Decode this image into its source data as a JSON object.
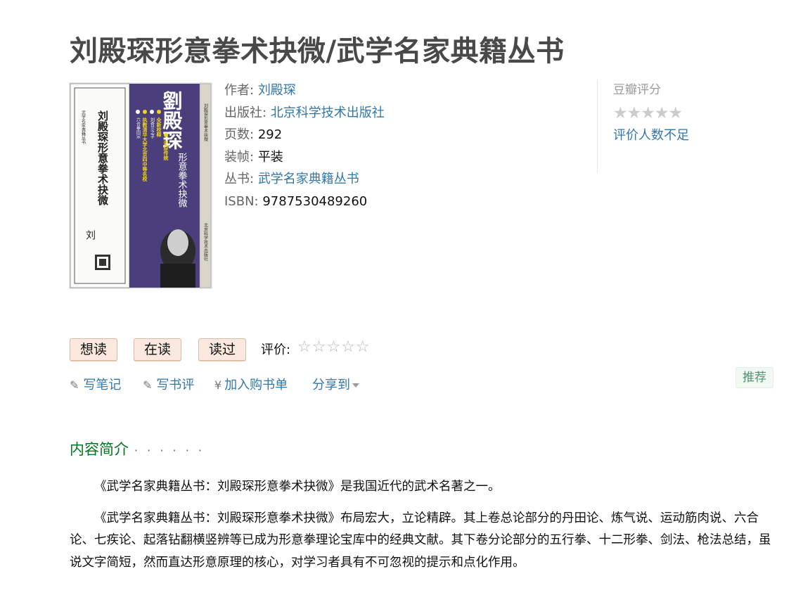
{
  "title": "刘殿琛形意拳术抉微/武学名家典籍丛书",
  "cover": {
    "series_vertical": "武学名家典籍丛书",
    "title_vertical": "刘殿琛形意拳术抉微",
    "author_big": "劉殿琛",
    "subtitle_vertical": "形意拳术抉微",
    "bullets": [
      "全新校释",
      "还原传统，从这里开始",
      "执教清华大学、北京四中等名校",
      "刘奇兰之子",
      "六合拳同宗"
    ],
    "publisher_vertical": "北京科学技术出版社"
  },
  "info": {
    "author_label": "作者:",
    "author": "刘殿琛",
    "publisher_label": "出版社:",
    "publisher": "北京科学技术出版社",
    "pages_label": "页数:",
    "pages": "292",
    "binding_label": "装帧:",
    "binding": "平装",
    "series_label": "丛书:",
    "series": "武学名家典籍丛书",
    "isbn_label": "ISBN:",
    "isbn": "9787530489260"
  },
  "rating": {
    "label": "豆瓣评分",
    "stars": "★★★★★",
    "note": "评价人数不足"
  },
  "actions": {
    "want": "想读",
    "reading": "在读",
    "read": "读过",
    "rate_label": "评价:",
    "rate_stars": "☆☆☆☆☆"
  },
  "links": {
    "note": "写笔记",
    "review": "写书评",
    "cart": "加入购书单",
    "share": "分享到"
  },
  "recommend": "推荐",
  "intro": {
    "heading": "内容简介",
    "dots": "· · · · · ·",
    "p1": "《武学名家典籍丛书：刘殿琛形意拳术抉微》是我国近代的武术名著之一。",
    "p2": "《武学名家典籍丛书：刘殿琛形意拳术抉微》布局宏大，立论精辟。其上卷总论部分的丹田论、炼气说、运动筋肉说、六合论、七疾论、起落钻翻横竖辨等已成为形意拳理论宝库中的经典文献。其下卷分论部分的五行拳、十二形拳、剑法、枪法总结，虽说文字简短，然而直达形意原理的核心，对学习者具有不可忽视的提示和点化作用。"
  },
  "colors": {
    "link": "#3377aa",
    "green_heading": "#007722",
    "button_bg": "#fbe9df",
    "cover_purple": "#4a3f7a",
    "cover_yellow": "#f3d21c"
  }
}
